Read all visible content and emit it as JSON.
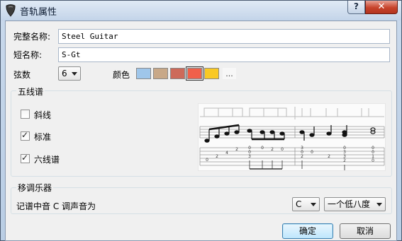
{
  "window": {
    "title": "音轨属性",
    "help_label": "?",
    "close_label": "✕"
  },
  "fields": {
    "full_name": {
      "label": "完整名称:",
      "value": "Steel Guitar"
    },
    "short_name": {
      "label": "短名称:",
      "value": "S-Gt"
    },
    "strings": {
      "label": "弦数",
      "value": "6"
    },
    "color": {
      "label": "颜色",
      "more_label": "..."
    }
  },
  "swatches": [
    {
      "name": "light-blue",
      "color": "#9fc6ea"
    },
    {
      "name": "tan",
      "color": "#c8a888"
    },
    {
      "name": "indian-red",
      "color": "#cd6a5a"
    },
    {
      "name": "tomato",
      "color": "#f0604a",
      "selected": true
    },
    {
      "name": "yellow",
      "color": "#f9c925"
    }
  ],
  "staff_group": {
    "title": "五线谱",
    "options": [
      {
        "label": "斜线",
        "checked": false
      },
      {
        "label": "标准",
        "checked": true
      },
      {
        "label": "六线谱",
        "checked": true
      }
    ],
    "tab_digits": [
      "0",
      "2",
      "4",
      "2",
      "0",
      "0",
      "3",
      "0",
      "2",
      "0",
      "3",
      "0",
      "2",
      "0",
      "2",
      "0",
      "3",
      "3",
      "2",
      "0",
      "0",
      "1",
      "0",
      "0",
      "0",
      "0",
      "2",
      "0",
      "0",
      "1"
    ]
  },
  "transpose_group": {
    "title": "移调乐器",
    "text": "记谱中音 C 调声音为",
    "key_value": "C",
    "octave_value": "一个低八度"
  },
  "buttons": {
    "ok": "确定",
    "cancel": "取消"
  }
}
